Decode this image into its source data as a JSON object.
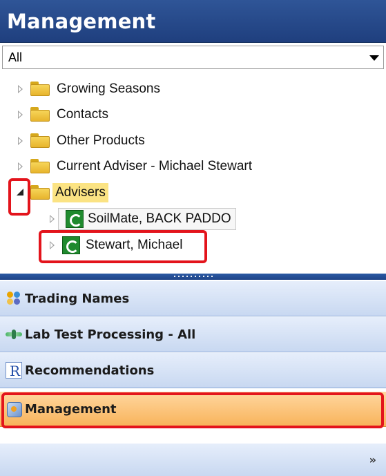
{
  "header": {
    "title": "Management"
  },
  "filter": {
    "selected": "All"
  },
  "tree": {
    "folders": [
      {
        "label": "Growing Seasons"
      },
      {
        "label": "Contacts"
      },
      {
        "label": "Other Products"
      },
      {
        "label": "Current Adviser - Michael Stewart"
      },
      {
        "label": "Advisers"
      }
    ],
    "children": [
      {
        "label": "SoilMate, BACK PADDO"
      },
      {
        "label": "Stewart, Michael"
      }
    ]
  },
  "nav": {
    "trading_names": "Trading Names",
    "lab_test_processing": "Lab Test Processing - All",
    "recommendations": "Recommendations",
    "management": "Management"
  },
  "footer": {
    "chevrons": "»"
  },
  "colors": {
    "header": "#2f5597",
    "active_nav": "#f8b35a",
    "highlight": "#e3141c"
  }
}
